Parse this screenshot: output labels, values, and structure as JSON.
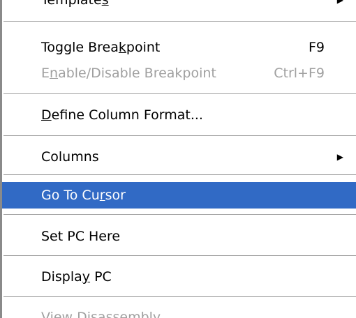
{
  "menu": {
    "items": [
      {
        "label_before": "Template",
        "mnemonic": "s",
        "label_after": "",
        "has_submenu": true,
        "enabled": true
      },
      {
        "label_before": "Toggle Brea",
        "mnemonic": "k",
        "label_after": "point",
        "shortcut": "F9",
        "enabled": true
      },
      {
        "label_before": "E",
        "mnemonic": "n",
        "label_after": "able/Disable Breakpoint",
        "shortcut": "Ctrl+F9",
        "enabled": false
      },
      {
        "label_before": "",
        "mnemonic": "D",
        "label_after": "efine Column Format...",
        "enabled": true
      },
      {
        "label_before": "Columns",
        "mnemonic": "",
        "label_after": "",
        "has_submenu": true,
        "enabled": true
      },
      {
        "label_before": "Go To Cu",
        "mnemonic": "r",
        "label_after": "sor",
        "enabled": true,
        "highlighted": true
      },
      {
        "label_before": "Set PC Here",
        "mnemonic": "",
        "label_after": "",
        "enabled": true
      },
      {
        "label_before": "Displa",
        "mnemonic": "y",
        "label_after": " PC",
        "enabled": true
      },
      {
        "label_before": "View Disassembly",
        "mnemonic": "",
        "label_after": "",
        "enabled": false
      }
    ]
  },
  "colors": {
    "highlight_bg": "#316ac5",
    "highlight_fg": "#ffffff",
    "disabled_fg": "#a0a0a0",
    "separator": "#a0a0a0"
  },
  "icons": {
    "submenu_arrow": "submenu-arrow-icon"
  }
}
